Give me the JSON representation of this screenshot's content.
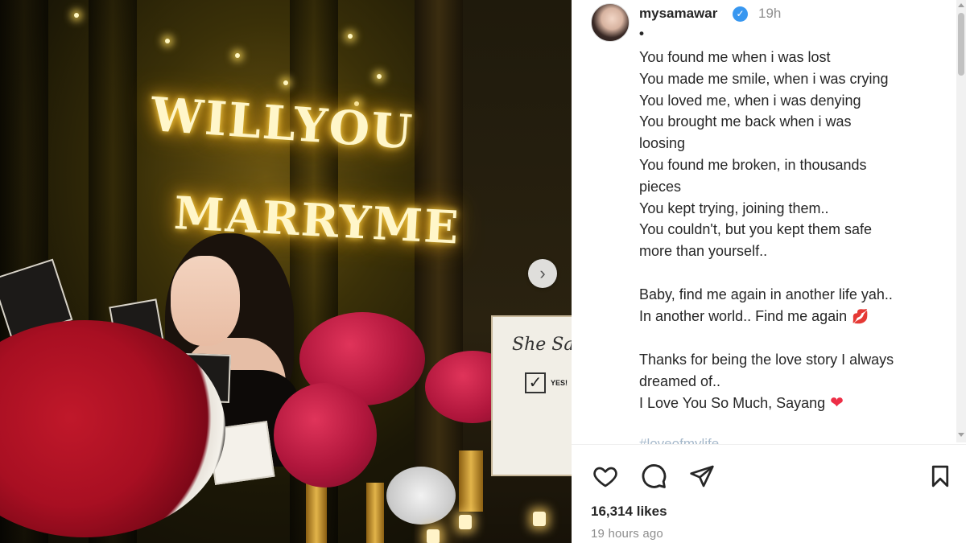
{
  "photo": {
    "sign_line1": "WILLYOU",
    "sign_line2": "MARRYME",
    "easel_text": "She Said",
    "easel_check": "✓",
    "easel_yes": "YES!",
    "next_arrow": "›"
  },
  "post": {
    "username": "mysamawar",
    "verified_mark": "✓",
    "time_ago": "19h",
    "dot": "•",
    "caption_lines": [
      "You found me when i was lost",
      "You made me smile, when i was crying",
      "You loved me, when i was denying",
      "You brought me back when i was",
      "loosing",
      "You found me broken, in thousands",
      "pieces",
      "You kept trying, joining them..",
      "You couldn't, but you kept them safe",
      "more than yourself..",
      "",
      "Baby, find me again in another life yah..",
      "In another world.. Find me again",
      "",
      "Thanks for being the love story I always",
      "dreamed of..",
      "I Love You So Much, Sayang"
    ],
    "lips_emoji": "💋",
    "heart_emoji": "❤",
    "hashtag": "#loveofmylife",
    "likes": "16,314 likes",
    "posted": "19 hours ago"
  },
  "icons": {
    "like": "heart-outline-icon",
    "comment": "comment-icon",
    "share": "send-icon",
    "save": "bookmark-icon",
    "next": "chevron-right-icon"
  },
  "colors": {
    "verified": "#3897f0",
    "text": "#262626",
    "muted": "#8e8e8e",
    "heart": "#ed2e46"
  }
}
